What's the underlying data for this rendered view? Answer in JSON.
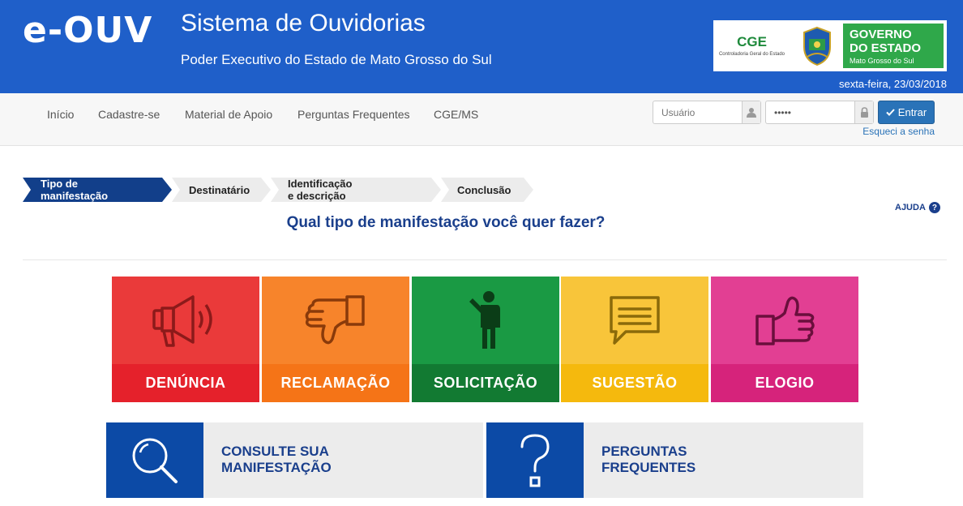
{
  "header": {
    "brand": "e-OUV",
    "title": "Sistema de Ouvidorias",
    "subtitle": "Poder Executivo do Estado de Mato Grosso do Sul",
    "logo": {
      "cge": "CGE",
      "cge_sub": "Controladoria Geral do Estado",
      "gov_line1": "GOVERNO",
      "gov_line2": "DO ESTADO",
      "gov_line3": "Mato Grosso do Sul"
    },
    "date": "sexta-feira, 23/03/2018"
  },
  "nav": {
    "items": [
      "Início",
      "Cadastre-se",
      "Material de Apoio",
      "Perguntas Frequentes",
      "CGE/MS"
    ]
  },
  "login": {
    "user_placeholder": "Usuário",
    "password_value": "•••••",
    "submit_label": "Entrar",
    "forgot_label": "Esqueci a senha"
  },
  "steps": {
    "items": [
      "Tipo de manifestação",
      "Destinatário",
      "Identificação e descrição",
      "Conclusão"
    ],
    "active_index": 0
  },
  "help_label": "AJUDA",
  "question": "Qual tipo de manifestação você quer fazer?",
  "tiles": [
    {
      "label": "DENÚNCIA",
      "icon": "megaphone-icon",
      "top_color": "#ea3a3a",
      "bottom_color": "#e5212b"
    },
    {
      "label": "RECLAMAÇÃO",
      "icon": "thumbs-down-icon",
      "top_color": "#f7842b",
      "bottom_color": "#f57417"
    },
    {
      "label": "SOLICITAÇÃO",
      "icon": "person-raising-hand-icon",
      "top_color": "#1a9a44",
      "bottom_color": "#127a32"
    },
    {
      "label": "SUGESTÃO",
      "icon": "speech-bubble-icon",
      "top_color": "#f8c53a",
      "bottom_color": "#f5b90d"
    },
    {
      "label": "ELOGIO",
      "icon": "thumbs-up-icon",
      "top_color": "#e23f93",
      "bottom_color": "#d6237b"
    }
  ],
  "cards": [
    {
      "line1": "CONSULTE SUA",
      "line2": "MANIFESTAÇÃO",
      "icon": "magnifier-icon"
    },
    {
      "line1": "PERGUNTAS",
      "line2": "FREQUENTES",
      "icon": "question-mark-icon"
    }
  ]
}
